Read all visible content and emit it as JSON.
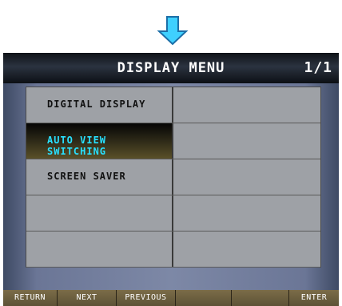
{
  "title": "DISPLAY MENU",
  "page": "1/1",
  "menu": {
    "rows": [
      {
        "label": "DIGITAL DISPLAY",
        "selected": false
      },
      {
        "label": "AUTO VIEW SWITCHING",
        "selected": true
      },
      {
        "label": "SCREEN SAVER",
        "selected": false
      },
      {
        "label": "",
        "selected": false
      },
      {
        "label": "",
        "selected": false
      }
    ]
  },
  "footer": {
    "return": "RETURN",
    "next": "NEXT",
    "previous": "PREVIOUS",
    "enter": "ENTER"
  },
  "colors": {
    "selected_text": "#28e0ff",
    "cell": "#9ea1a6",
    "arrow": "#3fd0ff"
  },
  "icons": {
    "top": "down-arrow-icon"
  }
}
